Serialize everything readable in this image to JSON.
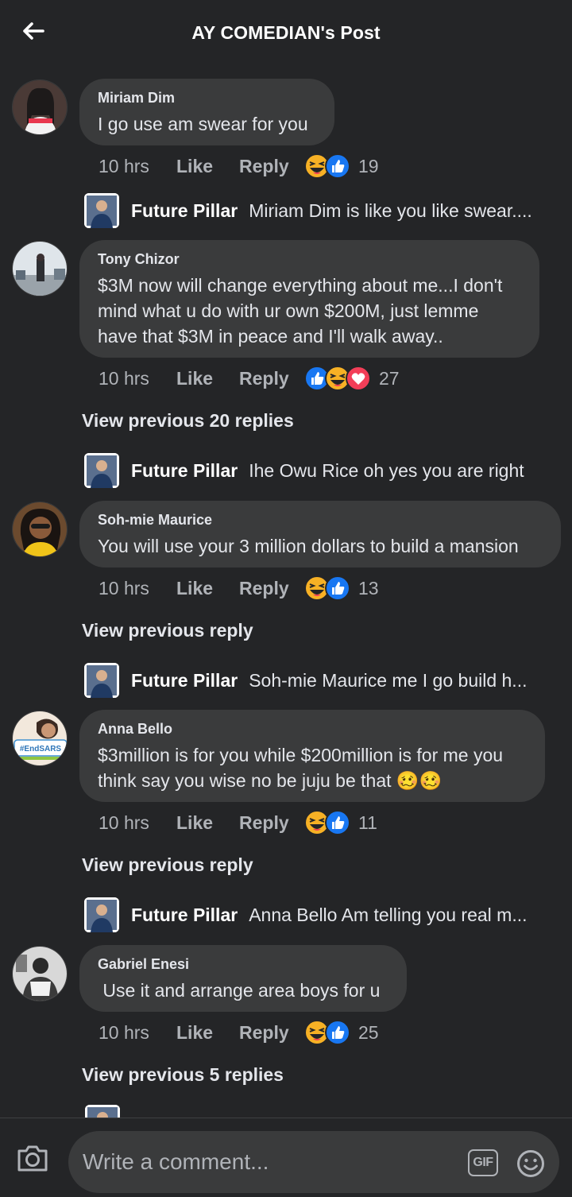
{
  "header": {
    "title": "AY COMEDIAN's Post"
  },
  "colors": {
    "background": "#242527",
    "bubble": "#3a3b3c",
    "text": "#e4e6eb",
    "muted": "#b0b3b8",
    "like_blue": "#1877f2",
    "haha_yellow": "#f7b125",
    "love_red": "#f33e58"
  },
  "comments": [
    {
      "author": "Miriam Dim",
      "text": "I go use am swear for you",
      "time": "10 hrs",
      "like_label": "Like",
      "reply_label": "Reply",
      "reactions": [
        "haha-icon",
        "like-icon"
      ],
      "reaction_count": "19",
      "view_previous": "",
      "reply": {
        "name": "Future Pillar",
        "text": "Miriam Dim is like you like swear...."
      }
    },
    {
      "author": "Tony Chizor",
      "text": "$3M now will change everything about me...I don't mind what u do with ur own $200M, just lemme have that $3M in peace and I'll walk away..",
      "time": "10 hrs",
      "like_label": "Like",
      "reply_label": "Reply",
      "reactions": [
        "like-icon",
        "haha-icon",
        "love-icon"
      ],
      "reaction_count": "27",
      "view_previous": "View previous 20 replies",
      "reply": {
        "name": "Future Pillar",
        "text": "Ihe Owu Rice oh yes you are right"
      }
    },
    {
      "author": "Soh-mie Maurice",
      "text": "You will use your 3 million dollars to build a mansion",
      "time": "10 hrs",
      "like_label": "Like",
      "reply_label": "Reply",
      "reactions": [
        "haha-icon",
        "like-icon"
      ],
      "reaction_count": "13",
      "view_previous": "View previous reply",
      "reply": {
        "name": "Future Pillar",
        "text": "Soh-mie Maurice me I go build h..."
      }
    },
    {
      "author": "Anna Bello",
      "text": "$3million is for you while $200million is for me you think say you wise no be juju be that 🥴🥴",
      "avatar_badge": "#EndSARS",
      "time": "10 hrs",
      "like_label": "Like",
      "reply_label": "Reply",
      "reactions": [
        "haha-icon",
        "like-icon"
      ],
      "reaction_count": "11",
      "view_previous": "View previous reply",
      "reply": {
        "name": "Future Pillar",
        "text": "Anna Bello Am telling you real m..."
      }
    },
    {
      "author": "Gabriel Enesi",
      "text": " Use it and arrange area boys for u",
      "time": "10 hrs",
      "like_label": "Like",
      "reply_label": "Reply",
      "reactions": [
        "haha-icon",
        "like-icon"
      ],
      "reaction_count": "25",
      "view_previous": "View previous 5 replies",
      "reply": null
    }
  ],
  "composer": {
    "placeholder": "Write a comment...",
    "gif_label": "GIF"
  }
}
